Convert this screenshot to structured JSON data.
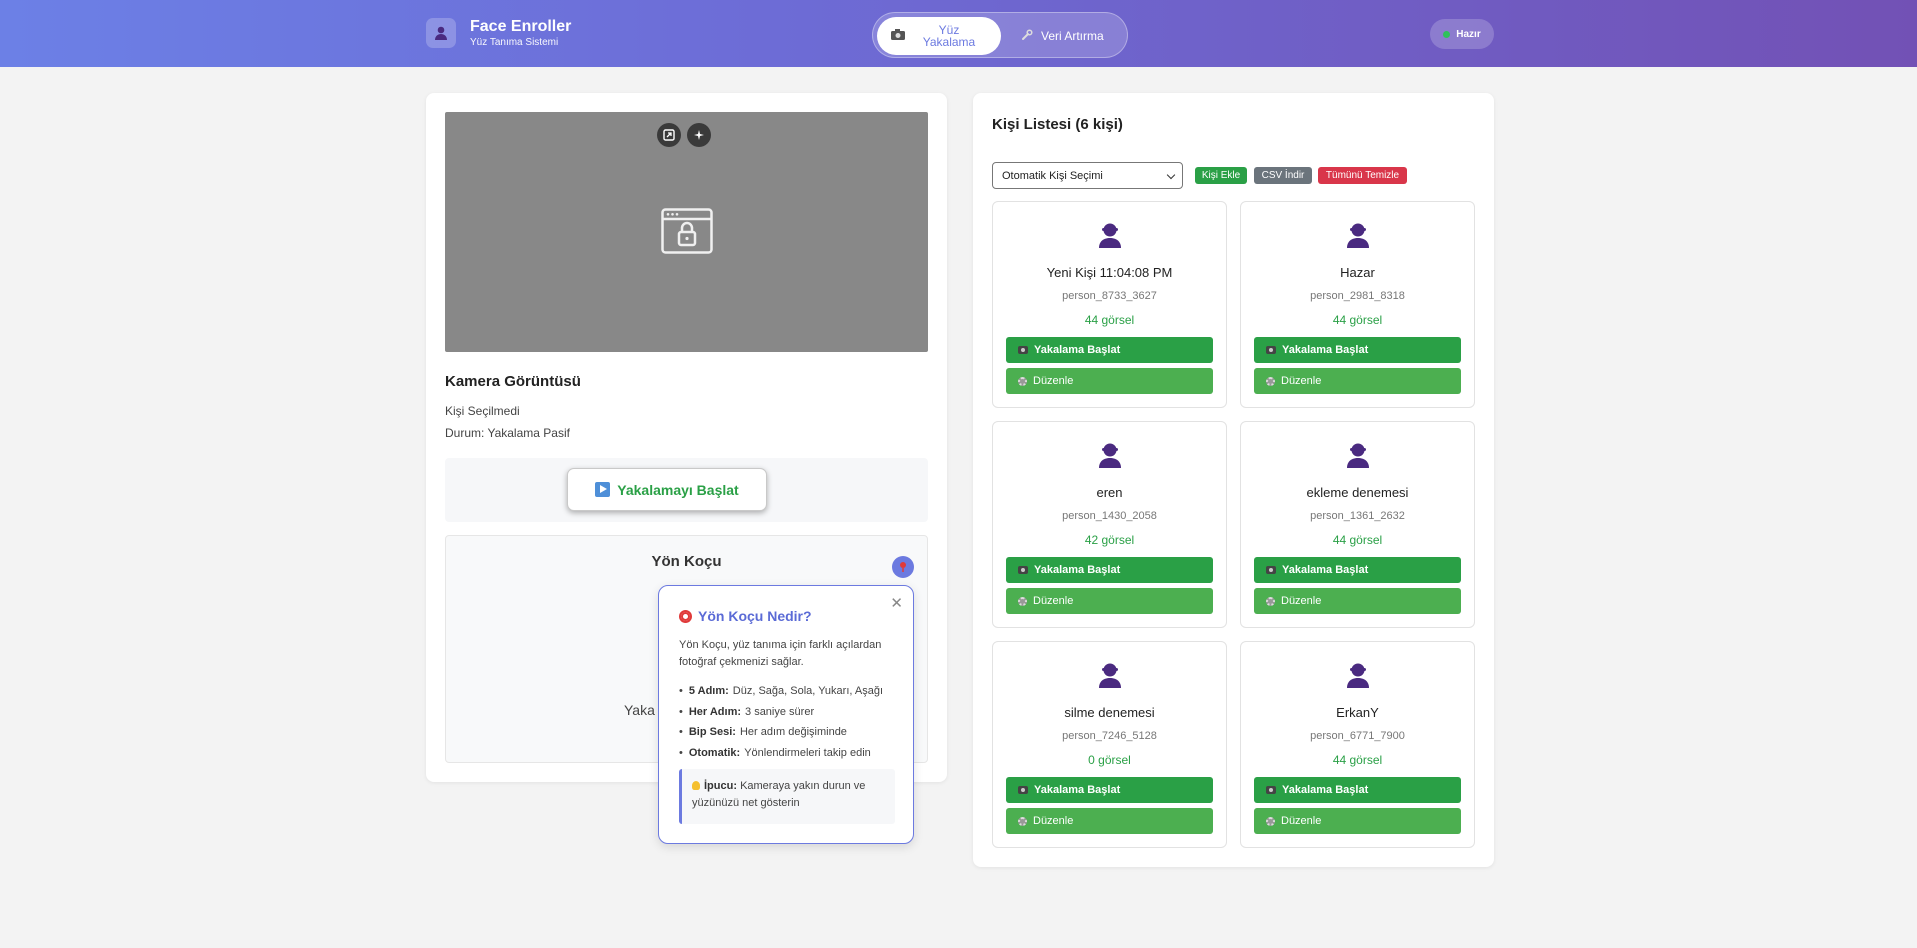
{
  "header": {
    "title": "Face Enroller",
    "subtitle": "Yüz Tanıma Sistemi",
    "tabs": [
      {
        "label": "Yüz Yakalama",
        "active": true
      },
      {
        "label": "Veri Artırma",
        "active": false
      }
    ],
    "status": "Hazır"
  },
  "camera": {
    "title": "Kamera Görüntüsü",
    "person_status": "Kişi Seçilmedi",
    "capture_status": "Durum: Yakalama Pasif",
    "start_button": "Yakalamayı Başlat"
  },
  "coach": {
    "title": "Yön Koçu",
    "partial_text": "Yaka"
  },
  "popover": {
    "title": "Yön Koçu Nedir?",
    "description": "Yön Koçu, yüz tanıma için farklı açılardan fotoğraf çekmenizi sağlar.",
    "items": [
      {
        "label": "5 Adım:",
        "text": "Düz, Sağa, Sola, Yukarı, Aşağı"
      },
      {
        "label": "Her Adım:",
        "text": "3 saniye sürer"
      },
      {
        "label": "Bip Sesi:",
        "text": "Her adım değişiminde"
      },
      {
        "label": "Otomatik:",
        "text": "Yönlendirmeleri takip edin"
      }
    ],
    "tip_label": "İpucu:",
    "tip_text": "Kameraya yakın durun ve yüzünüzü net gösterin"
  },
  "person_list": {
    "title": "Kişi Listesi (6 kişi)",
    "select_value": "Otomatik Kişi Seçimi",
    "buttons": {
      "add": "Kişi Ekle",
      "csv": "CSV İndir",
      "clear": "Tümünü Temizle"
    },
    "start_label": "Yakalama Başlat",
    "edit_label": "Düzenle",
    "people": [
      {
        "name": "Yeni Kişi 11:04:08 PM",
        "id": "person_8733_3627",
        "count": "44 görsel"
      },
      {
        "name": "Hazar",
        "id": "person_2981_8318",
        "count": "44 görsel"
      },
      {
        "name": "eren",
        "id": "person_1430_2058",
        "count": "42 görsel"
      },
      {
        "name": "ekleme denemesi",
        "id": "person_1361_2632",
        "count": "44 görsel"
      },
      {
        "name": "silme denemesi",
        "id": "person_7246_5128",
        "count": "0 görsel"
      },
      {
        "name": "ErkanY",
        "id": "person_6771_7900",
        "count": "44 görsel"
      }
    ]
  },
  "colors": {
    "accent": "#6c7ae0",
    "success": "#2aa046",
    "danger": "#d9364a",
    "avatar": "#4a2a80"
  }
}
